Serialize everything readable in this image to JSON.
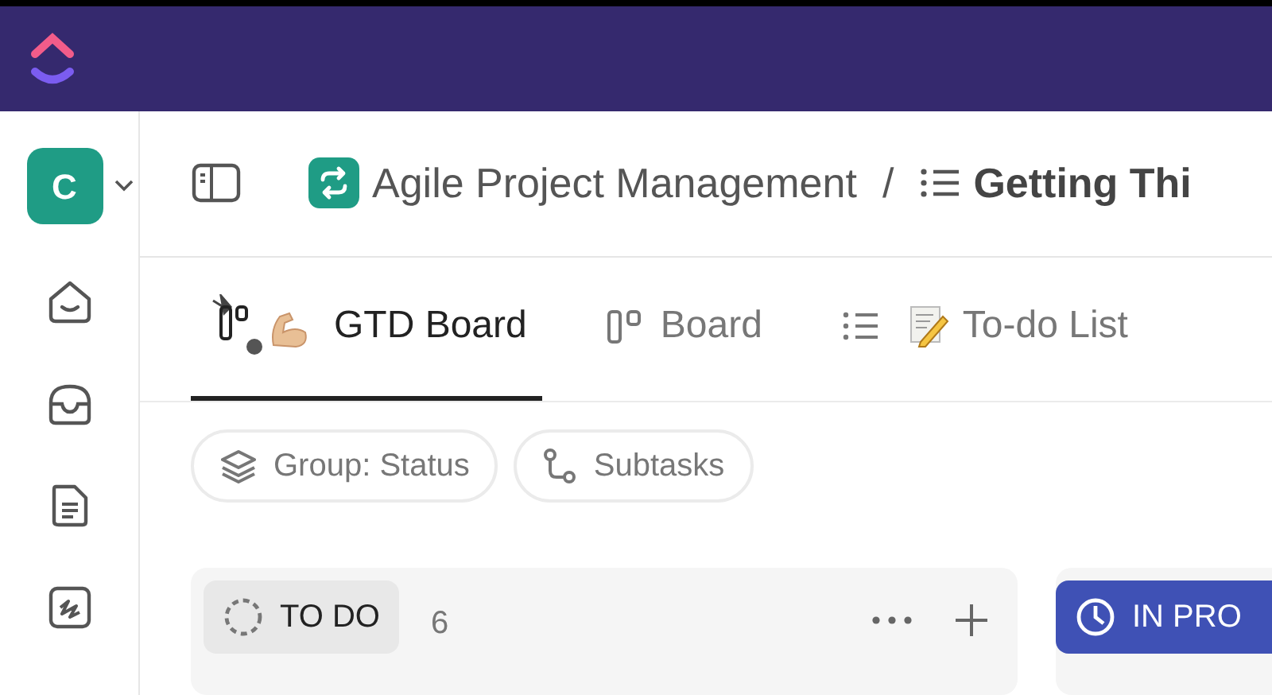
{
  "workspace": {
    "initial": "C"
  },
  "breadcrumb": [
    {
      "kind": "space",
      "label": "Agile Project Management"
    },
    {
      "kind": "list",
      "label": "Getting Thi"
    }
  ],
  "breadcrumb_separator": "/",
  "tabs": [
    {
      "kind": "gtd",
      "label": "GTD Board",
      "selected": true
    },
    {
      "kind": "board",
      "label": "Board",
      "selected": false
    },
    {
      "kind": "list",
      "label": "To-do List",
      "selected": false
    }
  ],
  "filters": [
    {
      "kind": "group",
      "label": "Group: Status"
    },
    {
      "kind": "subtasks",
      "label": "Subtasks"
    }
  ],
  "columns": [
    {
      "kind": "todo",
      "label": "TO DO",
      "count": "6",
      "color": "#e8e8e8"
    },
    {
      "kind": "progress",
      "label": "IN PRO",
      "color": "#3f51b5"
    }
  ]
}
